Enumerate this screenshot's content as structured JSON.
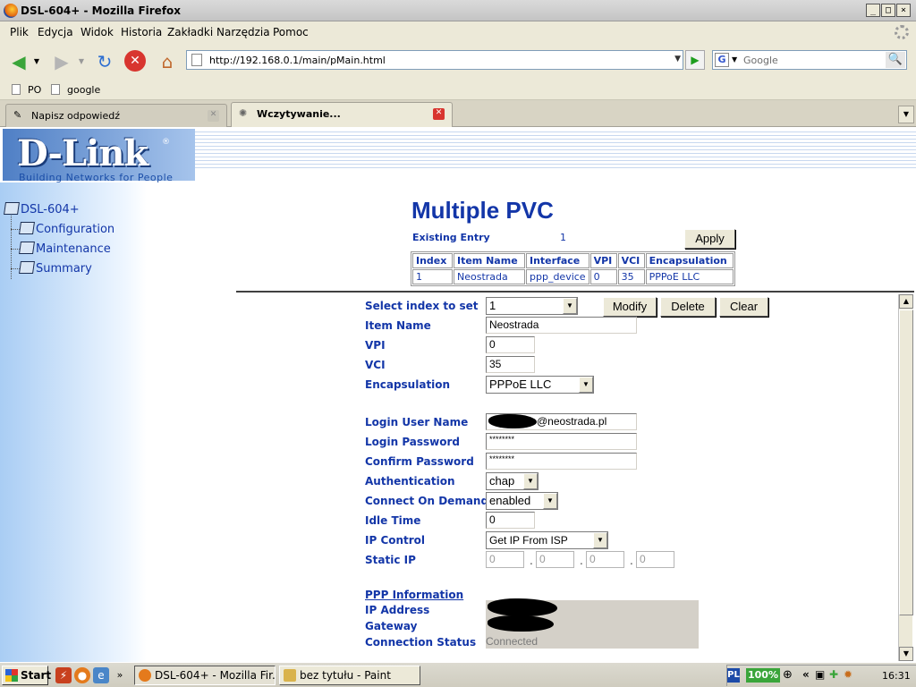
{
  "window": {
    "title": "DSL-604+ - Mozilla Firefox",
    "controls": [
      "_",
      "□",
      "×"
    ]
  },
  "menu": {
    "items": [
      "Plik",
      "Edycja",
      "Widok",
      "Historia",
      "Zakładki",
      "Narzędzia",
      "Pomoc"
    ]
  },
  "nav": {
    "url": "http://192.168.0.1/main/pMain.html",
    "search_placeholder": "Google"
  },
  "bookmarks": [
    "PO",
    "google"
  ],
  "tabs": [
    {
      "label": "Napisz odpowiedź",
      "active": false
    },
    {
      "label": "Wczytywanie...",
      "active": true
    }
  ],
  "dlink": {
    "logo": "D-Link",
    "reg": "®",
    "tagline": "Building Networks for People"
  },
  "tree": {
    "root": "DSL-604+",
    "children": [
      "Configuration",
      "Maintenance",
      "Summary"
    ]
  },
  "page": {
    "title": "Multiple PVC",
    "existing_label": "Existing Entry",
    "existing_value": "1",
    "apply_label": "Apply",
    "table": {
      "headers": [
        "Index",
        "Item Name",
        "Interface",
        "VPI",
        "VCI",
        "Encapsulation"
      ],
      "rows": [
        [
          "1",
          "Neostrada",
          "ppp_device",
          "0",
          "35",
          "PPPoE LLC"
        ]
      ]
    }
  },
  "form": {
    "select_index_label": "Select index to set",
    "select_index_value": "1",
    "modify_label": "Modify",
    "delete_label": "Delete",
    "clear_label": "Clear",
    "item_name_label": "Item Name",
    "item_name_value": "Neostrada",
    "vpi_label": "VPI",
    "vpi_value": "0",
    "vci_label": "VCI",
    "vci_value": "35",
    "encap_label": "Encapsulation",
    "encap_value": "PPPoE LLC",
    "login_user_label": "Login User Name",
    "login_user_value": "@neostrada.pl",
    "login_pass_label": "Login Password",
    "login_pass_value": "********",
    "confirm_pass_label": "Confirm Password",
    "confirm_pass_value": "********",
    "auth_label": "Authentication",
    "auth_value": "chap",
    "cod_label": "Connect On Demand",
    "cod_value": "enabled",
    "idle_label": "Idle Time",
    "idle_value": "0",
    "ipc_label": "IP Control",
    "ipc_value": "Get IP From ISP",
    "static_label": "Static IP",
    "static_octets": [
      "0",
      "0",
      "0",
      "0"
    ],
    "ppp_info_label": "PPP Information",
    "ip_address_label": "IP Address",
    "gateway_label": "Gateway",
    "conn_status_label": "Connection Status",
    "conn_status_value": "Connected"
  },
  "taskbar": {
    "start_label": "Start",
    "items": [
      {
        "label": "DSL-604+ - Mozilla Fir...",
        "active": true
      },
      {
        "label": "bez tytułu - Paint",
        "active": false
      }
    ],
    "lang": "PL",
    "battery": "100%",
    "clock": "16:31"
  }
}
